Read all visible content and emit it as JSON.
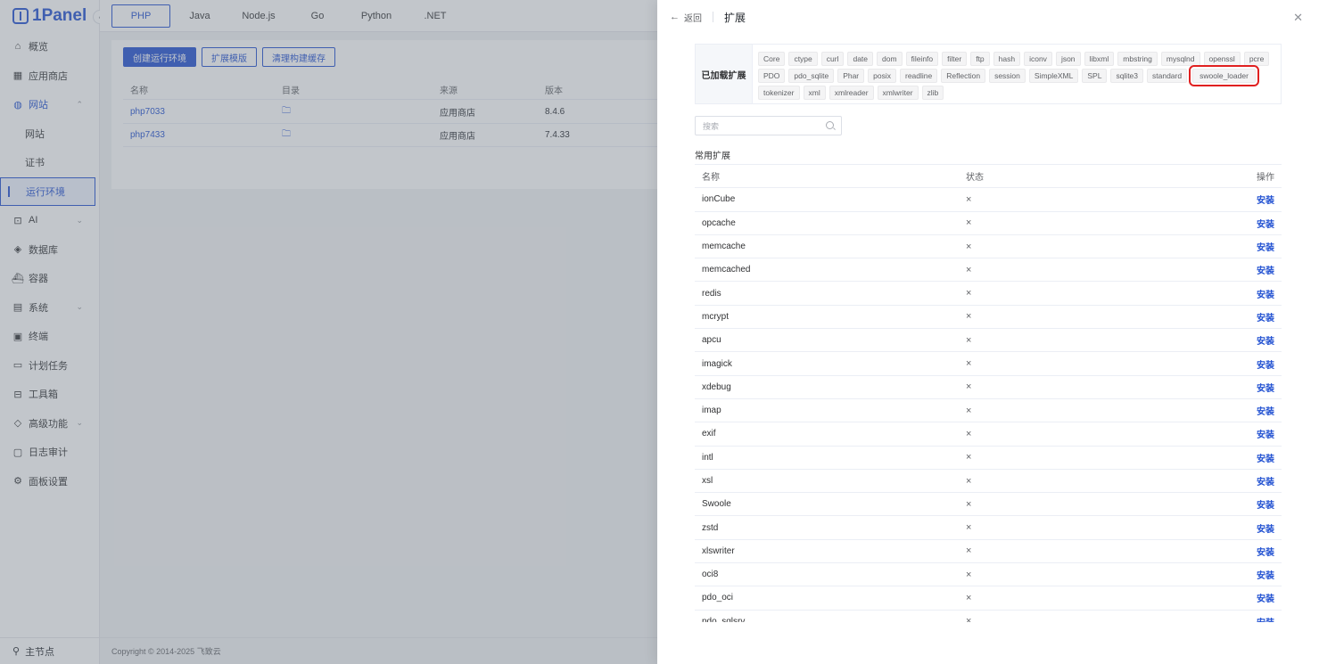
{
  "app": {
    "logo": "1Panel",
    "sidebar": {
      "items": [
        {
          "label": "概览",
          "icon": "home-icon"
        },
        {
          "label": "应用商店",
          "icon": "grid-icon"
        },
        {
          "label": "网站",
          "icon": "globe-icon"
        },
        {
          "label": "网站"
        },
        {
          "label": "证书"
        },
        {
          "label": "运行环境"
        },
        {
          "label": "AI",
          "icon": "robot-icon"
        },
        {
          "label": "数据库",
          "icon": "layers-icon"
        },
        {
          "label": "容器",
          "icon": "container-icon"
        },
        {
          "label": "系统",
          "icon": "system-icon"
        },
        {
          "label": "终端",
          "icon": "terminal-icon"
        },
        {
          "label": "计划任务",
          "icon": "calendar-icon"
        },
        {
          "label": "工具箱",
          "icon": "toolbox-icon"
        },
        {
          "label": "高级功能",
          "icon": "diamond-icon"
        },
        {
          "label": "日志审计",
          "icon": "log-icon"
        },
        {
          "label": "面板设置",
          "icon": "settings-icon"
        }
      ],
      "node": "主节点"
    },
    "lang_tabs": [
      "PHP",
      "Java",
      "Node.js",
      "Go",
      "Python",
      ".NET"
    ],
    "buttons": {
      "create": "创建运行环境",
      "template": "扩展模版",
      "clear_cache": "清理构建缓存"
    },
    "runtime_table": {
      "headers": [
        "名称",
        "目录",
        "来源",
        "版本"
      ],
      "rows": [
        {
          "name": "php7033",
          "source": "应用商店",
          "version": "8.4.6"
        },
        {
          "name": "php7433",
          "source": "应用商店",
          "version": "7.4.33"
        }
      ]
    },
    "footer": "Copyright © 2014-2025 飞致云"
  },
  "drawer": {
    "back_label": "返回",
    "title": "扩展",
    "loaded_label": "已加载扩展",
    "loaded_extensions": [
      "Core",
      "ctype",
      "curl",
      "date",
      "dom",
      "fileinfo",
      "filter",
      "ftp",
      "hash",
      "iconv",
      "json",
      "libxml",
      "mbstring",
      "mysqlnd",
      "openssl",
      "pcre",
      "PDO",
      "pdo_sqlite",
      "Phar",
      "posix",
      "readline",
      "Reflection",
      "session",
      "SimpleXML",
      "SPL",
      "sqlite3",
      "standard",
      "swoole_loader",
      "tokenizer",
      "xml",
      "xmlreader",
      "xmlwriter",
      "zlib"
    ],
    "highlighted_extension": "swoole_loader",
    "search_placeholder": "搜索",
    "section_title": "常用扩展",
    "table_headers": [
      "名称",
      "状态",
      "操作"
    ],
    "extensions": [
      {
        "name": "ionCube",
        "status": "×",
        "action": "安装"
      },
      {
        "name": "opcache",
        "status": "×",
        "action": "安装"
      },
      {
        "name": "memcache",
        "status": "×",
        "action": "安装"
      },
      {
        "name": "memcached",
        "status": "×",
        "action": "安装"
      },
      {
        "name": "redis",
        "status": "×",
        "action": "安装"
      },
      {
        "name": "mcrypt",
        "status": "×",
        "action": "安装"
      },
      {
        "name": "apcu",
        "status": "×",
        "action": "安装"
      },
      {
        "name": "imagick",
        "status": "×",
        "action": "安装"
      },
      {
        "name": "xdebug",
        "status": "×",
        "action": "安装"
      },
      {
        "name": "imap",
        "status": "×",
        "action": "安装"
      },
      {
        "name": "exif",
        "status": "×",
        "action": "安装"
      },
      {
        "name": "intl",
        "status": "×",
        "action": "安装"
      },
      {
        "name": "xsl",
        "status": "×",
        "action": "安装"
      },
      {
        "name": "Swoole",
        "status": "×",
        "action": "安装"
      },
      {
        "name": "zstd",
        "status": "×",
        "action": "安装"
      },
      {
        "name": "xlswriter",
        "status": "×",
        "action": "安装"
      },
      {
        "name": "oci8",
        "status": "×",
        "action": "安装"
      },
      {
        "name": "pdo_oci",
        "status": "×",
        "action": "安装"
      },
      {
        "name": "pdo_sqlsrv",
        "status": "×",
        "action": "安装"
      }
    ]
  },
  "colors": {
    "accent": "#1f4fd1",
    "highlight": "#e02020"
  }
}
